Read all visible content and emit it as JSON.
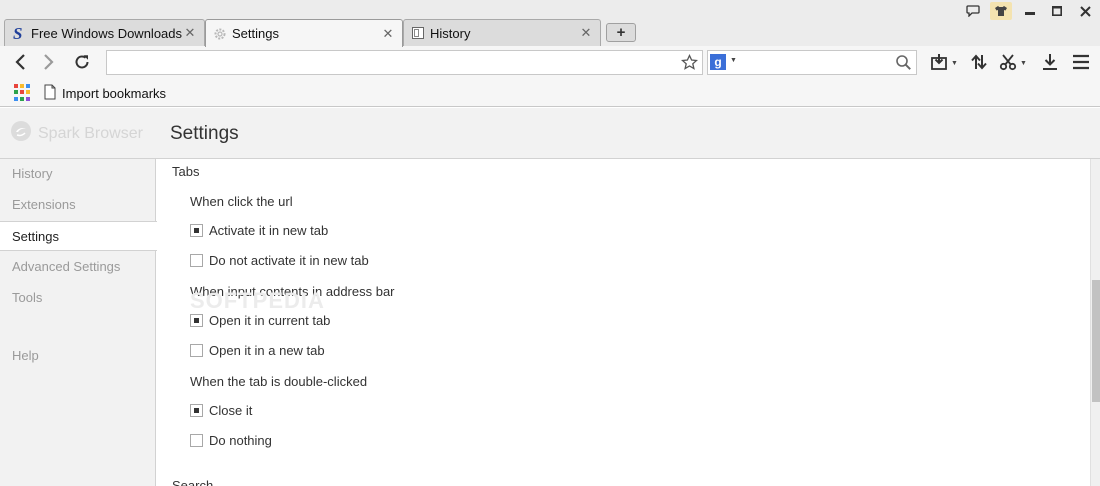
{
  "tabs": [
    {
      "title": "Free Windows Downloads",
      "favicon": "softpedia-s-icon",
      "active": false
    },
    {
      "title": "Settings",
      "favicon": "gear-icon",
      "active": true
    },
    {
      "title": "History",
      "favicon": "history-page-icon",
      "active": false
    }
  ],
  "new_tab_label": "+",
  "toolbar": {
    "address_value": "",
    "search_engine": "g",
    "search_value": ""
  },
  "bookmarks_bar": {
    "import_label": "Import bookmarks"
  },
  "header": {
    "brand": "Spark Browser",
    "title": "Settings"
  },
  "sidebar": {
    "items": [
      {
        "label": "History",
        "active": false
      },
      {
        "label": "Extensions",
        "active": false
      },
      {
        "label": "Settings",
        "active": true
      },
      {
        "label": "Advanced Settings",
        "active": false
      },
      {
        "label": "Tools",
        "active": false
      },
      {
        "label": "Help",
        "active": false
      }
    ]
  },
  "content": {
    "section_tabs": "Tabs",
    "groups": [
      {
        "title": "When click the url",
        "options": [
          {
            "label": "Activate it in new tab",
            "checked": true
          },
          {
            "label": "Do not activate it in new tab",
            "checked": false
          }
        ]
      },
      {
        "title": "When input contents in address bar",
        "options": [
          {
            "label": "Open it in current tab",
            "checked": true
          },
          {
            "label": "Open it in a new tab",
            "checked": false
          }
        ]
      },
      {
        "title": "When the tab is double-clicked",
        "options": [
          {
            "label": "Close it",
            "checked": true
          },
          {
            "label": "Do nothing",
            "checked": false
          }
        ]
      }
    ],
    "section_search": "Search"
  },
  "watermark": "SOFTPEDIA",
  "colors": {
    "apps_grid": [
      "#e8453c",
      "#f9bb2d",
      "#3b8ef0",
      "#2ca24c",
      "#e8453c",
      "#f9bb2d",
      "#3b8ef0",
      "#2ca24c",
      "#8b4fd6"
    ]
  }
}
